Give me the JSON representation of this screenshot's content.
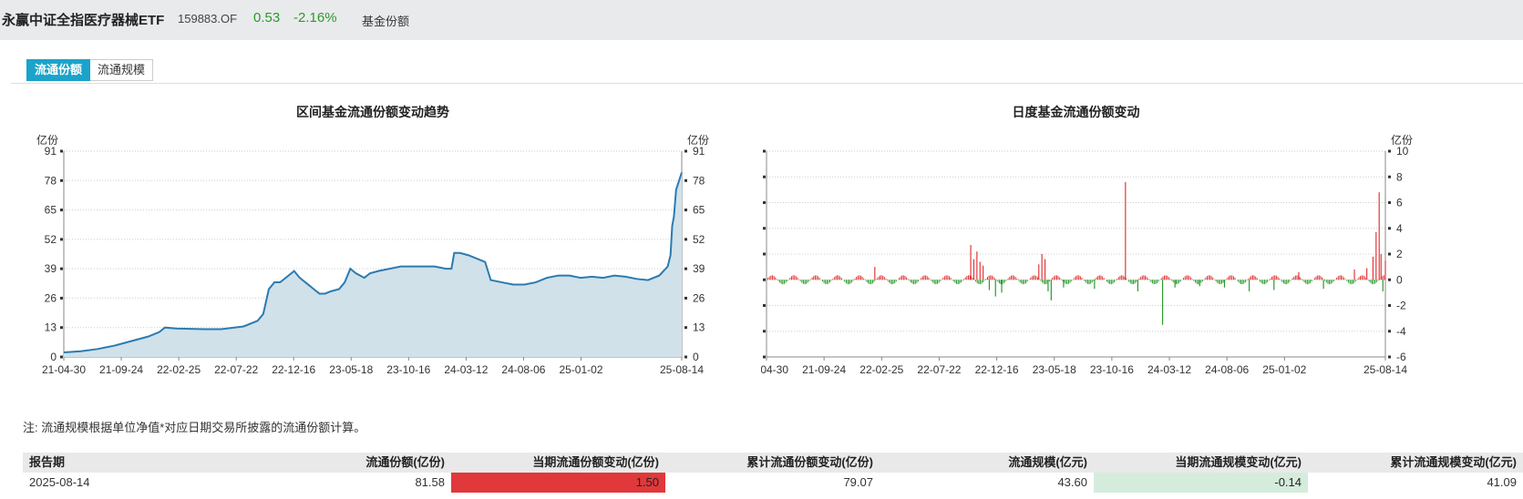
{
  "header": {
    "fund_name": "永赢中证全指医疗器械ETF",
    "fund_code": "159883.OF",
    "price": "0.53",
    "change": "-2.16%",
    "nav_label": "基金份额"
  },
  "tabs": [
    {
      "label": "流通份额",
      "active": true
    },
    {
      "label": "流通规模",
      "active": false
    }
  ],
  "note": "注:   流通规模根据单位净值*对应日期交易所披露的流通份额计算。",
  "colors": {
    "accent": "#1ba3c9",
    "line": "#2b7bb0",
    "area": "#d0e1ea",
    "up": "#e0383b",
    "down": "#2a9a2a"
  },
  "chart_data": [
    {
      "type": "area",
      "title": "区间基金流通份额变动趋势",
      "ylabel": "亿份",
      "ylabel_right": "亿份",
      "ylim": [
        0,
        91
      ],
      "yticks": [
        "0",
        "13",
        "26",
        "39",
        "52",
        "65",
        "78",
        "91"
      ],
      "xticks": [
        "21-04-30",
        "21-09-24",
        "22-02-25",
        "22-07-22",
        "22-12-16",
        "23-05-18",
        "23-10-16",
        "24-03-12",
        "24-08-06",
        "25-01-02",
        "25-08-14"
      ],
      "grid": true,
      "series": [
        {
          "values": [
            [
              0,
              2
            ],
            [
              0.03,
              2.5
            ],
            [
              0.06,
              3.5
            ],
            [
              0.09,
              5
            ],
            [
              0.12,
              7
            ],
            [
              0.15,
              9
            ],
            [
              0.17,
              11
            ],
            [
              0.18,
              13
            ],
            [
              0.2,
              12.6
            ],
            [
              0.25,
              12.3
            ],
            [
              0.28,
              12.3
            ],
            [
              0.32,
              13.5
            ],
            [
              0.345,
              16
            ],
            [
              0.355,
              19
            ],
            [
              0.365,
              30
            ],
            [
              0.375,
              33
            ],
            [
              0.385,
              33
            ],
            [
              0.4,
              36
            ],
            [
              0.41,
              38
            ],
            [
              0.42,
              35
            ],
            [
              0.43,
              33
            ],
            [
              0.445,
              30
            ],
            [
              0.455,
              28
            ],
            [
              0.465,
              28
            ],
            [
              0.475,
              29
            ],
            [
              0.49,
              30
            ],
            [
              0.5,
              33
            ],
            [
              0.51,
              39
            ],
            [
              0.52,
              37
            ],
            [
              0.535,
              35
            ],
            [
              0.545,
              37
            ],
            [
              0.56,
              38
            ],
            [
              0.58,
              39
            ],
            [
              0.6,
              40
            ],
            [
              0.62,
              40
            ],
            [
              0.64,
              40
            ],
            [
              0.66,
              40
            ],
            [
              0.68,
              39
            ],
            [
              0.69,
              39
            ],
            [
              0.695,
              46
            ],
            [
              0.705,
              46
            ],
            [
              0.72,
              45
            ],
            [
              0.74,
              43
            ],
            [
              0.75,
              42
            ],
            [
              0.76,
              34
            ],
            [
              0.78,
              33
            ],
            [
              0.8,
              32
            ],
            [
              0.82,
              32
            ],
            [
              0.84,
              33
            ],
            [
              0.86,
              35
            ],
            [
              0.88,
              36
            ],
            [
              0.9,
              36
            ],
            [
              0.92,
              35
            ],
            [
              0.94,
              35.5
            ],
            [
              0.96,
              35
            ],
            [
              0.98,
              36
            ],
            [
              1.0,
              35.5
            ],
            [
              1.02,
              34.5
            ],
            [
              1.04,
              34
            ],
            [
              1.06,
              36
            ],
            [
              1.075,
              40
            ],
            [
              1.08,
              45
            ],
            [
              1.083,
              58
            ],
            [
              1.086,
              62
            ],
            [
              1.09,
              74
            ],
            [
              1.1,
              81.58
            ]
          ]
        }
      ]
    },
    {
      "type": "bar",
      "title": "日度基金流通份额变动",
      "ylabel": "亿份",
      "ylabel_right": "亿份",
      "ylim": [
        -6,
        10
      ],
      "yticks": [
        "-6",
        "-4",
        "-2",
        "0",
        "2",
        "4",
        "6",
        "8",
        "10"
      ],
      "xticks": [
        "21-04-30",
        "21-09-24",
        "22-02-25",
        "22-07-22",
        "22-12-16",
        "23-05-18",
        "23-10-16",
        "24-03-12",
        "24-08-06",
        "25-01-02",
        "25-08-14"
      ],
      "grid": true,
      "spikes": [
        [
          0.175,
          1.0
        ],
        [
          0.33,
          2.7
        ],
        [
          0.335,
          1.6
        ],
        [
          0.34,
          2.2
        ],
        [
          0.345,
          1.4
        ],
        [
          0.35,
          1.1
        ],
        [
          0.36,
          -0.8
        ],
        [
          0.37,
          -1.3
        ],
        [
          0.38,
          -1.0
        ],
        [
          0.44,
          1.2
        ],
        [
          0.445,
          2.0
        ],
        [
          0.45,
          1.6
        ],
        [
          0.455,
          -0.9
        ],
        [
          0.46,
          -1.6
        ],
        [
          0.48,
          -0.6
        ],
        [
          0.53,
          -0.7
        ],
        [
          0.58,
          7.6
        ],
        [
          0.6,
          -0.9
        ],
        [
          0.64,
          -3.5
        ],
        [
          0.66,
          -0.6
        ],
        [
          0.7,
          -0.5
        ],
        [
          0.74,
          -0.6
        ],
        [
          0.78,
          -0.9
        ],
        [
          0.82,
          -0.8
        ],
        [
          0.86,
          0.6
        ],
        [
          0.9,
          -0.7
        ],
        [
          0.95,
          0.8
        ],
        [
          0.97,
          0.9
        ],
        [
          0.98,
          1.8
        ],
        [
          0.985,
          3.7
        ],
        [
          0.99,
          6.8
        ],
        [
          0.993,
          2.0
        ],
        [
          0.996,
          -0.9
        ],
        [
          1.0,
          1.5
        ]
      ]
    }
  ],
  "table": {
    "headers": [
      "报告期",
      "流通份额(亿份)",
      "当期流通份额变动(亿份)",
      "累计流通份额变动(亿份)",
      "流通规模(亿元)",
      "当期流通规模变动(亿元)",
      "累计流通规模变动(亿元)"
    ],
    "rows": [
      [
        "2025-08-14",
        "81.58",
        "1.50",
        "79.07",
        "43.60",
        "-0.14",
        "41.09"
      ]
    ]
  }
}
